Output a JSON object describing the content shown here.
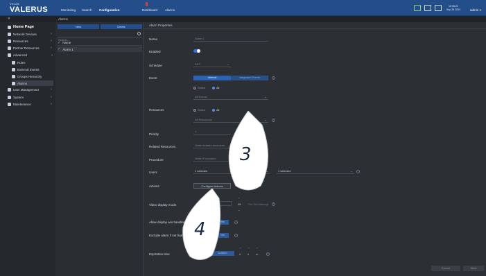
{
  "header": {
    "brand": "VICON",
    "product": "VALERUS",
    "nav": [
      "Monitoring",
      "Search",
      "Configuration",
      "Dashboard",
      "Alarms"
    ],
    "clock_time": "12:06:21",
    "clock_date": "Sep 25 2024",
    "user": "admin"
  },
  "breadcrumb": {
    "back": "«",
    "current": "Alarms"
  },
  "sidebar": {
    "home": "Home Page",
    "items": [
      {
        "label": "Network Devices"
      },
      {
        "label": "Resources"
      },
      {
        "label": "Partner Resources"
      },
      {
        "label": "Advanced"
      },
      {
        "label": "Rules"
      },
      {
        "label": "External Events"
      },
      {
        "label": "Groups Hierarchy"
      },
      {
        "label": "Alarms"
      },
      {
        "label": "User Management"
      },
      {
        "label": "System"
      },
      {
        "label": "Maintenance"
      }
    ]
  },
  "list": {
    "new_label": "New",
    "delete_label": "Delete",
    "search_placeholder": "Search...",
    "header": "Name",
    "rows": [
      "Alarm 1"
    ]
  },
  "props": {
    "title": "Alarm Properties",
    "labels": {
      "name": "Name",
      "enabled": "Enabled",
      "schedule": "Schedule",
      "event": "Event",
      "resources": "Resources",
      "priority": "Priority",
      "related": "Related Resources",
      "procedure": "Procedure",
      "users": "Users",
      "actions": "Actions",
      "video_mode": "Video display mode",
      "allow_display": "Allow display w/o handling",
      "exclude": "Exclude alarm if not handled",
      "expiration": "Expiration time"
    },
    "name_value": "Alarm 1",
    "schedule_value": "24/7",
    "event_tabs": [
      "Internal",
      "Integration Events"
    ],
    "radio_select": "Select",
    "radio_all": "All",
    "event_value": "All Events",
    "resources_value": "All Resources",
    "priority_value": "1",
    "related_placeholder": "Select related resources",
    "procedure_placeholder": "Select Procedure",
    "users_value_1": "1 selected",
    "users_value_2": "1 selected",
    "configure_actions": "Configure Actions",
    "video_number": "25",
    "video_unit": "Per Sec/Attempt",
    "option_label": "Yes",
    "custom_label": "Custom",
    "expiration_values": [
      "d",
      "h",
      "m"
    ],
    "cancel": "Cancel",
    "save": "Save"
  },
  "callouts": [
    "3",
    "4"
  ]
}
